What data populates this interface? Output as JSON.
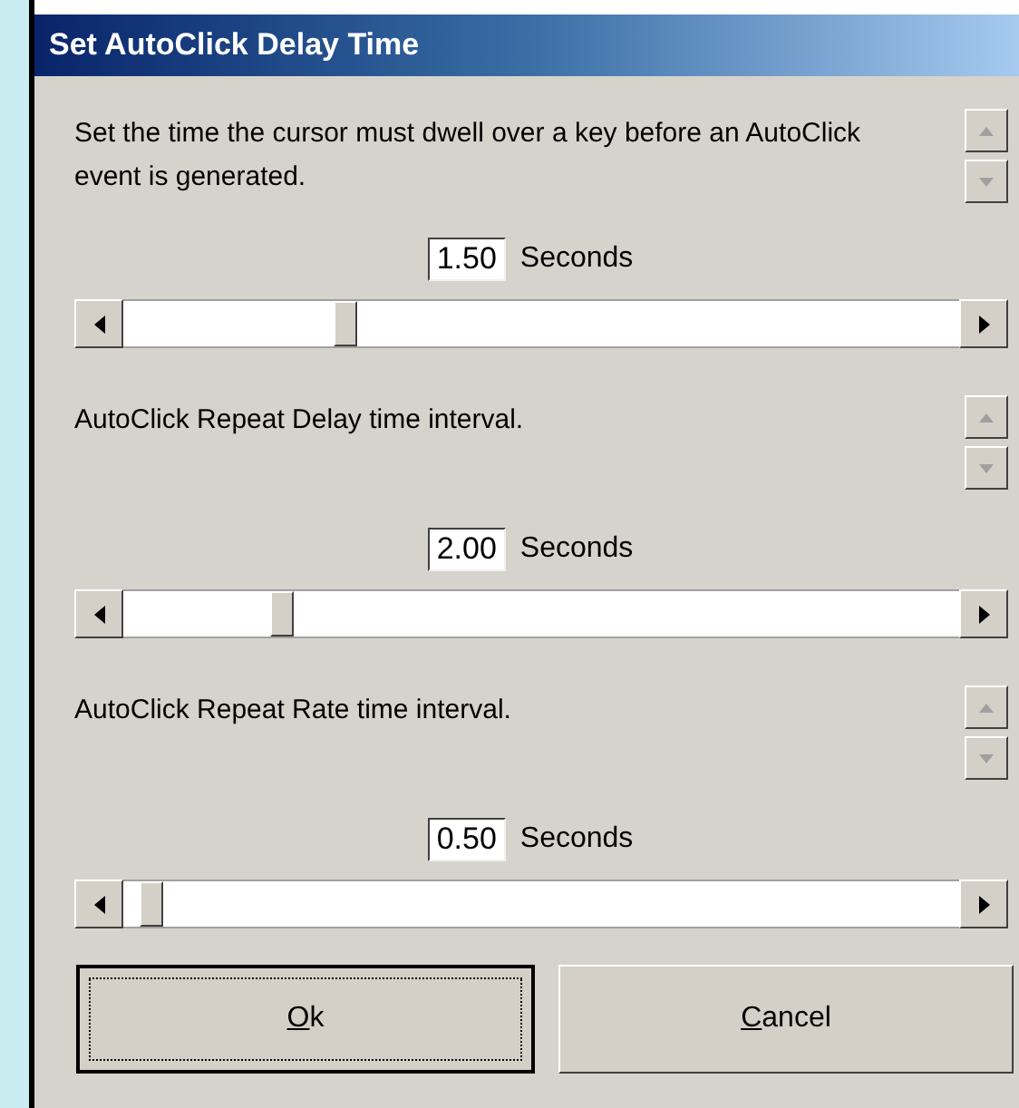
{
  "window": {
    "title": "Set AutoClick Delay Time"
  },
  "settings": [
    {
      "description": "Set the time the cursor must dwell over a key before an AutoClick event is generated.",
      "value": "1.50",
      "unit": "Seconds",
      "level": 0.26
    },
    {
      "description": "AutoClick Repeat Delay time interval.",
      "value": "2.00",
      "unit": "Seconds",
      "level": 0.18
    },
    {
      "description": "AutoClick Repeat Rate time interval.",
      "value": "0.50",
      "unit": "Seconds",
      "level": 0.02
    }
  ],
  "buttons": [
    {
      "label": "Ok",
      "focused": true
    },
    {
      "label": "Cancel",
      "focused": false
    }
  ]
}
